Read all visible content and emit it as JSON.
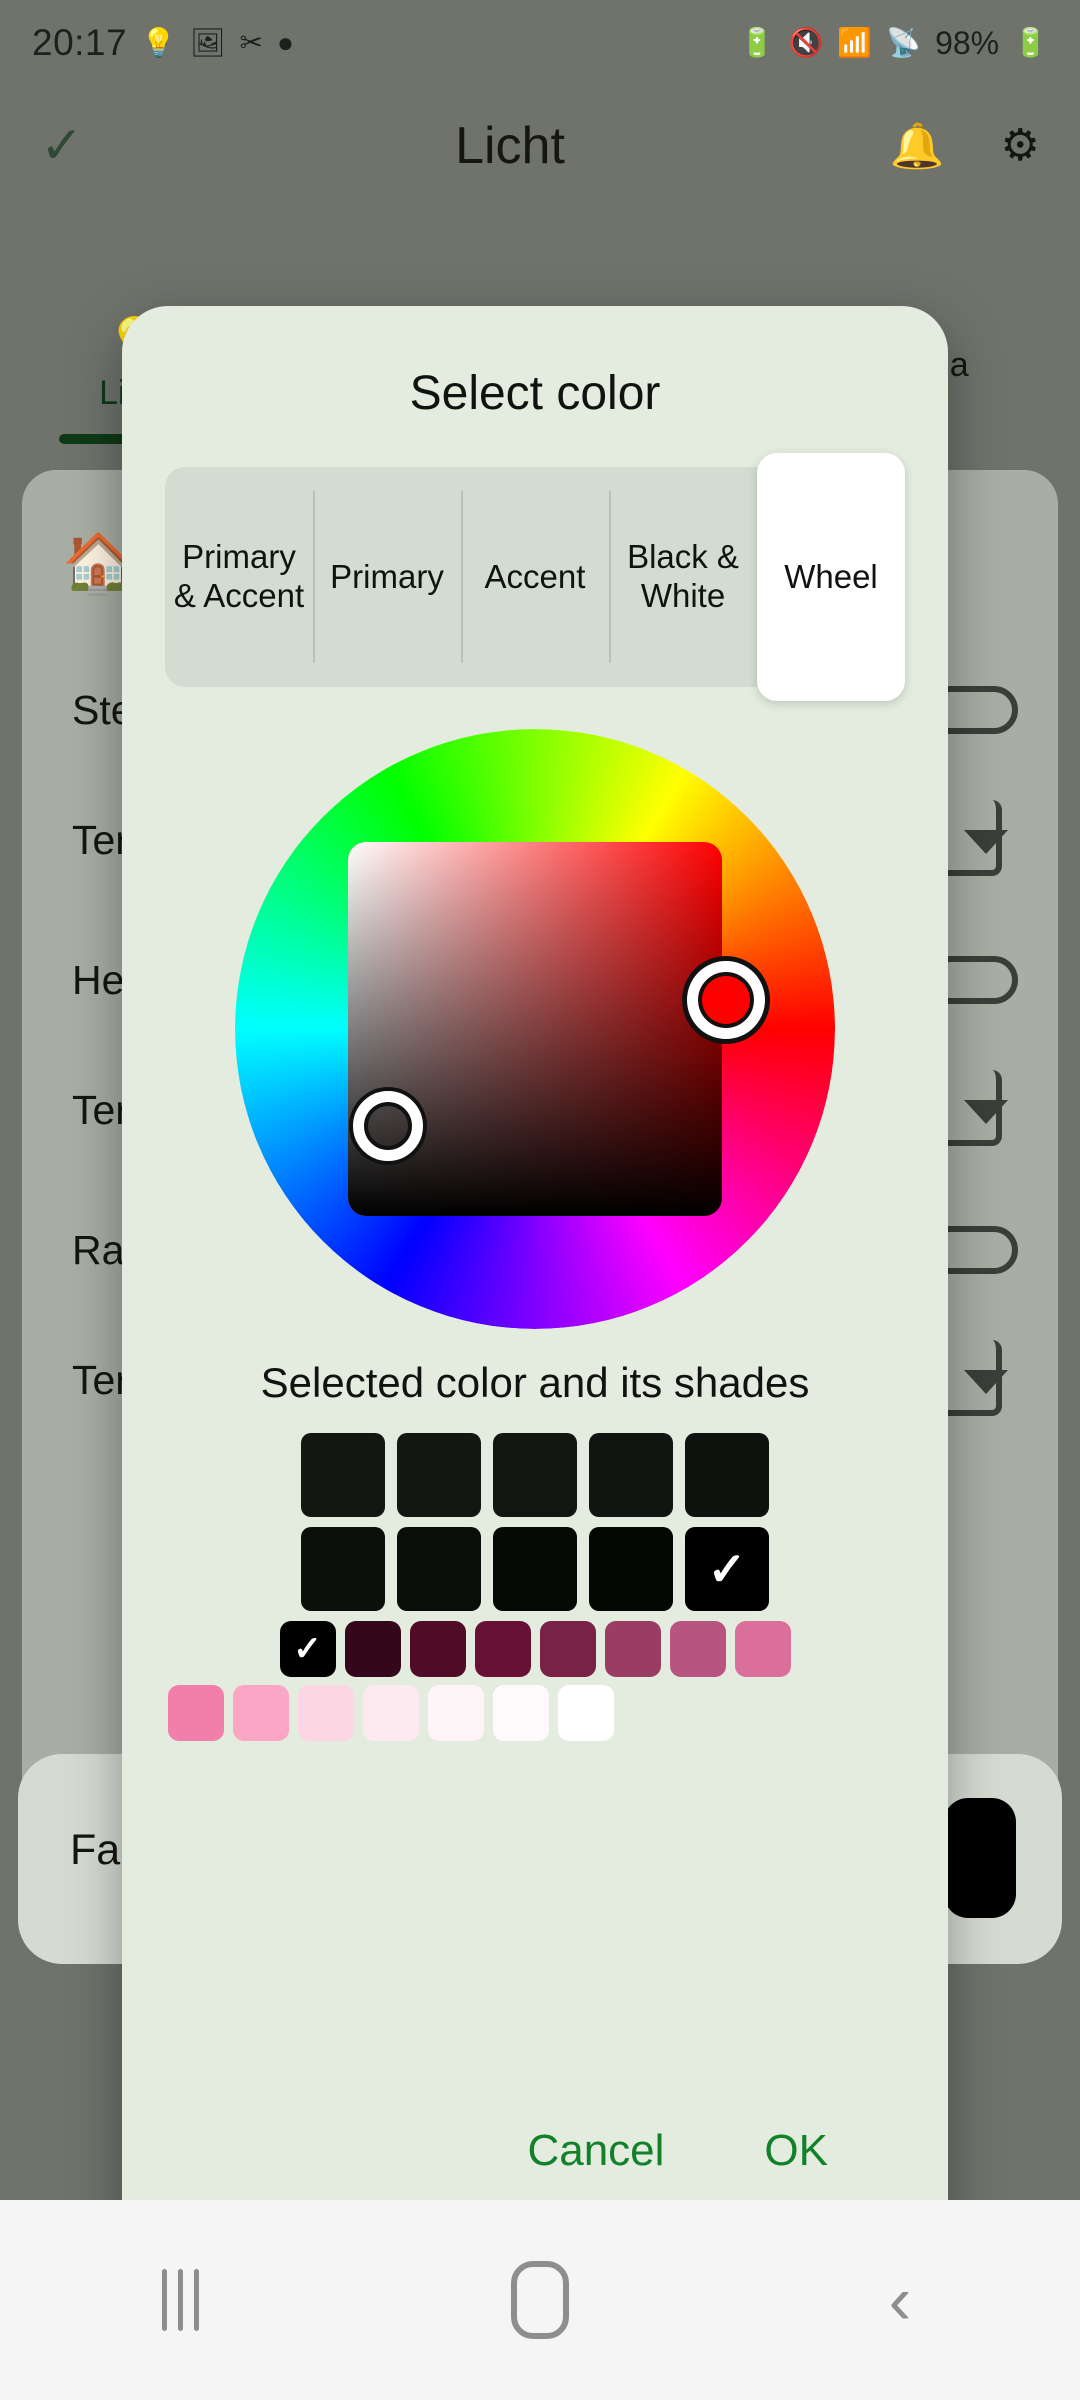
{
  "status_bar": {
    "time": "20:17",
    "left_icons": [
      "bulb-icon",
      "image-icon",
      "mute-media-icon",
      "dot-icon"
    ],
    "right_icons": [
      "battery-saver-icon",
      "vibrate-icon",
      "wifi-icon",
      "signal-icon"
    ],
    "battery_text": "98%"
  },
  "app_bar": {
    "confirm_icon": "check-icon",
    "title": "Licht",
    "notifications_icon": "bell-icon",
    "settings_icon": "gear-icon"
  },
  "app_tabs": [
    {
      "label": "Licht",
      "icon": "lightbulb-icon",
      "active": true
    },
    {
      "label": "Ma",
      "icon": "",
      "active": false
    }
  ],
  "app_rows": [
    {
      "label": "Ste"
    },
    {
      "label": "Ter Ste"
    },
    {
      "label": "He"
    },
    {
      "label": "Ter"
    },
    {
      "label": "Ra"
    },
    {
      "label": "Ter"
    }
  ],
  "bottom_card": {
    "label": "Far"
  },
  "dialog": {
    "title": "Select color",
    "tabs": [
      {
        "label": "Primary & Accent",
        "selected": false
      },
      {
        "label": "Primary",
        "selected": false
      },
      {
        "label": "Accent",
        "selected": false
      },
      {
        "label": "Black & White",
        "selected": false
      },
      {
        "label": "Wheel",
        "selected": true
      }
    ],
    "wheel": {
      "hue_marker_color": "#ff0000",
      "hue_marker_label": "hue-handle",
      "sv_marker_label": "saturation-value-handle",
      "square_base_color": "#ff0000"
    },
    "shades_title": "Selected color and its shades",
    "shade_rows": [
      {
        "name": "row-1",
        "swatches": [
          {
            "color": "#131712",
            "selected": false
          },
          {
            "color": "#131712",
            "selected": false
          },
          {
            "color": "#121510",
            "selected": false
          },
          {
            "color": "#111410",
            "selected": false
          },
          {
            "color": "#0e110d",
            "selected": false
          }
        ]
      },
      {
        "name": "row-2",
        "swatches": [
          {
            "color": "#0c0f0b",
            "selected": false
          },
          {
            "color": "#0a0d09",
            "selected": false
          },
          {
            "color": "#070906",
            "selected": false
          },
          {
            "color": "#050704",
            "selected": false
          },
          {
            "color": "#000000",
            "selected": true
          }
        ]
      },
      {
        "name": "row-3",
        "swatches": [
          {
            "color": "#000000",
            "selected": true
          },
          {
            "color": "#35071b",
            "selected": false
          },
          {
            "color": "#500b26",
            "selected": false
          },
          {
            "color": "#681134",
            "selected": false
          },
          {
            "color": "#7a2246",
            "selected": false
          },
          {
            "color": "#9b3c63",
            "selected": false
          },
          {
            "color": "#b85480",
            "selected": false
          },
          {
            "color": "#d96f9a",
            "selected": false
          }
        ]
      },
      {
        "name": "row-4",
        "swatches": [
          {
            "color": "#f27fa9",
            "selected": false
          },
          {
            "color": "#fba6c4",
            "selected": false
          },
          {
            "color": "#fcd6e2",
            "selected": false
          },
          {
            "color": "#fdeaf0",
            "selected": false
          },
          {
            "color": "#fdf5f7",
            "selected": false
          },
          {
            "color": "#fefafc",
            "selected": false
          },
          {
            "color": "#ffffff",
            "selected": false
          }
        ]
      }
    ],
    "cancel_label": "Cancel",
    "ok_label": "OK",
    "accent_color": "#12812a",
    "surface_color": "#e4ecdf"
  },
  "nav_bar": {
    "recents_label": "recents-icon",
    "home_label": "home-icon",
    "back_label": "back-icon"
  }
}
